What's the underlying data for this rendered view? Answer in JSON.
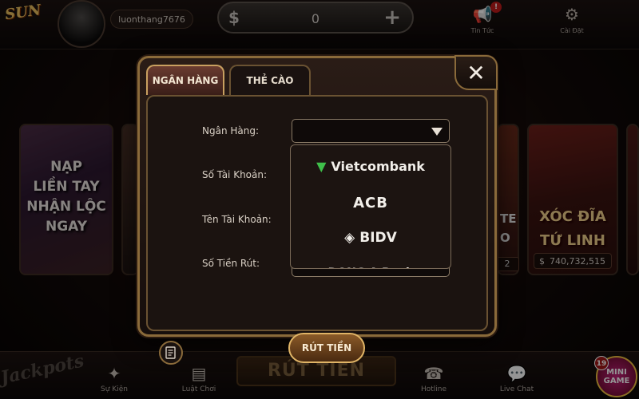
{
  "header": {
    "logo_text": "SUN",
    "username": "luonthang7676",
    "balance": "0",
    "currency_icon": "dollar-icon",
    "add_icon": "plus-icon",
    "notifications": {
      "label": "Tin Tức",
      "badge": "!"
    },
    "settings": {
      "label": "Cài Đặt"
    }
  },
  "tiles": {
    "left_text": [
      "NẠP",
      "LIỀN TAY",
      "NHẬN LỘC",
      "NGAY"
    ],
    "right_partial_text": [
      "TE",
      "O"
    ],
    "right_game_text": [
      "XÓC ĐĨA",
      "TỨ LINH"
    ],
    "right_game_amount": "740,732,515",
    "small_amount": "2"
  },
  "modal": {
    "tabs": [
      {
        "label": "NGÂN HÀNG",
        "active": true
      },
      {
        "label": "THẺ CÀO",
        "active": false
      }
    ],
    "fields": {
      "bank": {
        "label": "Ngân Hàng:",
        "value": ""
      },
      "account_number": {
        "label": "Số Tài Khoản:",
        "value": ""
      },
      "account_name": {
        "label": "Tên Tài Khoản:",
        "value": ""
      },
      "amount": {
        "label": "Số Tiền Rút:",
        "value": ""
      }
    },
    "bank_options": [
      "Vietcombank",
      "ACB",
      "BIDV",
      "DONG A Bank"
    ],
    "withdraw_button": "RÚT TIỀN",
    "close_icon": "close-icon"
  },
  "footer": {
    "jackpots_label": "Jackpots",
    "items": [
      {
        "label": "Sự Kiện",
        "icon": "event-icon"
      },
      {
        "label": "Luật Chơi",
        "icon": "rules-icon"
      },
      {
        "label": "Hotline",
        "icon": "phone-icon"
      },
      {
        "label": "Live Chat",
        "icon": "chat-icon"
      }
    ],
    "center_label": "RÚT TIỀN",
    "minigame": {
      "label_1": "MINI",
      "label_2": "GAME",
      "badge": "19"
    }
  },
  "colors": {
    "gold_border": "#8a6a3a",
    "accent_button": "#8a5a28",
    "background": "#0a0606"
  }
}
